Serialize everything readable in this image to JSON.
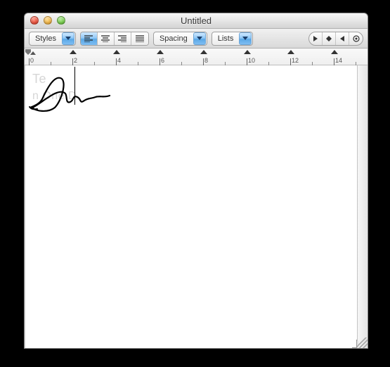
{
  "window": {
    "title": "Untitled"
  },
  "toolbar": {
    "styles": {
      "label": "Styles"
    },
    "spacing": {
      "label": "Spacing"
    },
    "lists": {
      "label": "Lists"
    }
  },
  "ruler": {
    "unit_labels": [
      "0",
      "2",
      "4",
      "6",
      "8",
      "10",
      "12",
      "14"
    ]
  },
  "document": {
    "watermark_line1": "Te",
    "watermark_line2": "  n One D"
  }
}
